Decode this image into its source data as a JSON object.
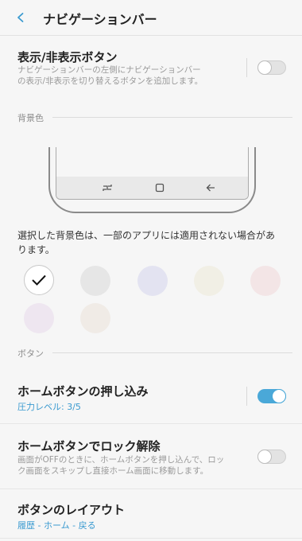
{
  "header": {
    "title": "ナビゲーションバー",
    "back_icon": "chevron-left-icon"
  },
  "show_hide": {
    "title": "表示/非表示ボタン",
    "desc_line1": "ナビゲーションバーの左側にナビゲーションバー",
    "desc_line2": "の表示/非表示を切り替えるボタンを追加します。",
    "enabled": false
  },
  "bg_section": {
    "label": "背景色"
  },
  "preview": {
    "icons": [
      "recent-apps-icon",
      "home-icon",
      "back-arrow-icon"
    ]
  },
  "bg_note": {
    "line1": "選択した背景色は、一部のアプリには適用されない場合があ",
    "line2": "ります。"
  },
  "swatches": [
    {
      "name": "white",
      "color": "#ffffff",
      "selected": true
    },
    {
      "name": "gray",
      "color": "#e6e6e6",
      "selected": false
    },
    {
      "name": "lavender",
      "color": "#e3e3f1",
      "selected": false
    },
    {
      "name": "cream",
      "color": "#f1efe5",
      "selected": false
    },
    {
      "name": "pink",
      "color": "#f3e5e6",
      "selected": false
    },
    {
      "name": "lilac",
      "color": "#eee6f0",
      "selected": false
    },
    {
      "name": "beige",
      "color": "#f0ebe6",
      "selected": false
    }
  ],
  "buttons_section": {
    "label": "ボタン"
  },
  "home_press": {
    "title": "ホームボタンの押し込み",
    "sub": "圧力レベル: 3/5",
    "enabled": true
  },
  "unlock": {
    "title": "ホームボタンでロック解除",
    "desc_line1": "画面がOFFのときに、ホームボタンを押し込んで、ロッ",
    "desc_line2": "ク画面をスキップし直接ホーム画面に移動します。",
    "enabled": false
  },
  "layout": {
    "title": "ボタンのレイアウト",
    "sub": "履歴 - ホーム - 戻る"
  },
  "colors": {
    "accent": "#4aa8d8",
    "link": "#3a9ad0"
  }
}
